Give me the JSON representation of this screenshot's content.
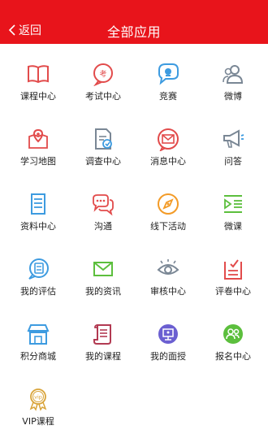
{
  "header": {
    "back_label": "返回",
    "title": "全部应用"
  },
  "colors": {
    "header_bg": "#e8141b",
    "red": "#e24b4b",
    "blue": "#3d9be0",
    "orange": "#f39b27",
    "green": "#5cbf3d",
    "gray": "#7a8795",
    "purple": "#6b5fd1"
  },
  "apps": [
    {
      "label": "课程中心",
      "icon": "book-icon"
    },
    {
      "label": "考试中心",
      "icon": "exam-icon"
    },
    {
      "label": "竞赛",
      "icon": "trophy-chat-icon"
    },
    {
      "label": "微博",
      "icon": "users-icon"
    },
    {
      "label": "学习地图",
      "icon": "map-pin-icon"
    },
    {
      "label": "调查中心",
      "icon": "survey-doc-icon"
    },
    {
      "label": "消息中心",
      "icon": "message-envelope-icon"
    },
    {
      "label": "问答",
      "icon": "megaphone-icon"
    },
    {
      "label": "资料中心",
      "icon": "document-icon"
    },
    {
      "label": "沟通",
      "icon": "chat-bubbles-icon"
    },
    {
      "label": "线下活动",
      "icon": "compass-icon"
    },
    {
      "label": "微课",
      "icon": "video-list-icon"
    },
    {
      "label": "我的评估",
      "icon": "evaluation-chat-icon"
    },
    {
      "label": "我的资讯",
      "icon": "envelope-icon"
    },
    {
      "label": "审核中心",
      "icon": "eye-icon"
    },
    {
      "label": "评卷中心",
      "icon": "grading-icon"
    },
    {
      "label": "积分商城",
      "icon": "store-icon"
    },
    {
      "label": "我的课程",
      "icon": "scroll-icon"
    },
    {
      "label": "我的面授",
      "icon": "teacher-board-icon"
    },
    {
      "label": "报名中心",
      "icon": "signup-group-icon"
    },
    {
      "label": "VIP课程",
      "icon": "vip-badge-icon"
    }
  ]
}
